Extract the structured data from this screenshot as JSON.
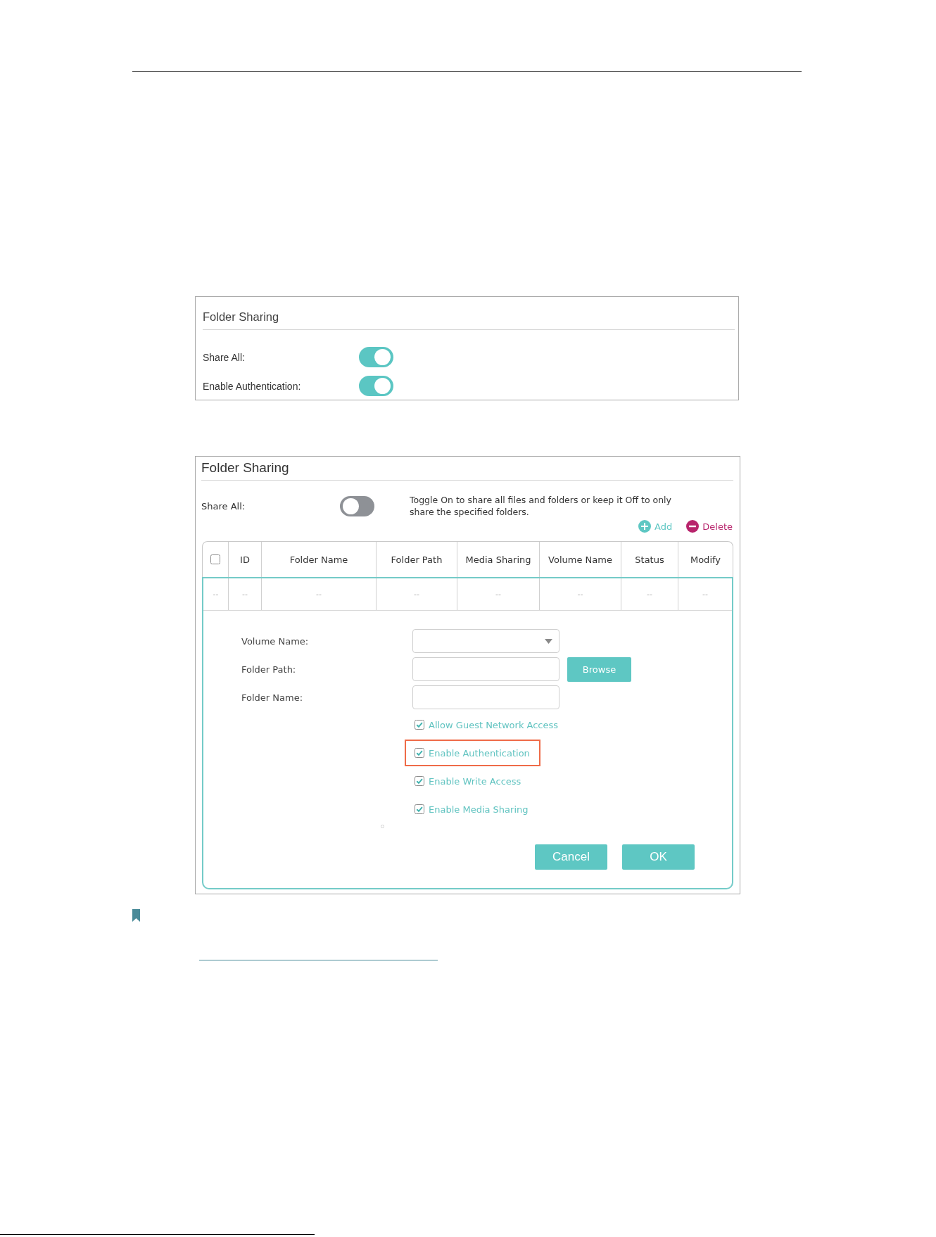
{
  "panels": [
    {
      "kind": "simple",
      "title": "Folder Sharing",
      "settings": [
        {
          "label": "Share All:",
          "on": true
        },
        {
          "label": "Enable Authentication:",
          "on": true
        }
      ]
    },
    {
      "kind": "table",
      "title": "Folder Sharing",
      "share_all": {
        "label": "Share All:",
        "on": false,
        "description": "Toggle On to share all files and folders or keep it Off to only\nshare the specified folders."
      },
      "actions": [
        {
          "kind": "add",
          "label": "Add"
        },
        {
          "kind": "delete",
          "label": "Delete"
        }
      ],
      "table": {
        "columns": [
          {
            "kind": "checkbox",
            "checked": false
          },
          {
            "kind": "text",
            "label": "ID"
          },
          {
            "kind": "text",
            "label": "Folder Name"
          },
          {
            "kind": "text",
            "label": "Folder Path"
          },
          {
            "kind": "text",
            "label": "Media Sharing"
          },
          {
            "kind": "text",
            "label": "Volume Name"
          },
          {
            "kind": "text",
            "label": "Status"
          },
          {
            "kind": "text",
            "label": "Modify"
          }
        ],
        "rows": [
          [
            "--",
            "--",
            "--",
            "--",
            "--",
            "--",
            "--",
            "--"
          ]
        ]
      },
      "form": {
        "fields": [
          {
            "kind": "select",
            "label": "Volume Name:"
          },
          {
            "kind": "input",
            "label": "Folder Path:",
            "button": "Browse"
          },
          {
            "kind": "input",
            "label": "Folder Name:"
          }
        ],
        "options": [
          {
            "label": "Allow Guest Network Access",
            "checked": true,
            "highlighted": false
          },
          {
            "label": "Enable Authentication",
            "checked": true,
            "highlighted": true
          },
          {
            "label": "Enable Write Access",
            "checked": true,
            "highlighted": false
          },
          {
            "label": "Enable Media Sharing",
            "checked": true,
            "highlighted": false
          }
        ],
        "buttons": [
          "Cancel",
          "OK"
        ]
      }
    }
  ]
}
